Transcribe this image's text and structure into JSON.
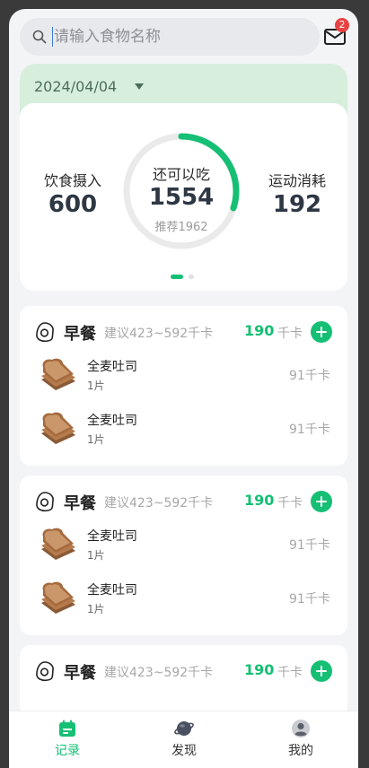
{
  "search": {
    "placeholder": "请输入食物名称",
    "badge_count": "2"
  },
  "date": {
    "value": "2024/04/04"
  },
  "summary": {
    "intake_label": "饮食摄入",
    "intake_value": "600",
    "remaining_label": "还可以吃",
    "remaining_value": "1554",
    "recommended_text": "推荐1962",
    "burn_label": "运动消耗",
    "burn_value": "192",
    "ring_progress": 0.3
  },
  "meals": [
    {
      "title": "早餐",
      "suggestion": "建议423~592千卡",
      "kcal": "190",
      "kcal_unit": "千卡",
      "foods": [
        {
          "name": "全麦吐司",
          "qty": "1片",
          "kcal": "91千卡"
        },
        {
          "name": "全麦吐司",
          "qty": "1片",
          "kcal": "91千卡"
        }
      ]
    },
    {
      "title": "早餐",
      "suggestion": "建议423~592千卡",
      "kcal": "190",
      "kcal_unit": "千卡",
      "foods": [
        {
          "name": "全麦吐司",
          "qty": "1片",
          "kcal": "91千卡"
        },
        {
          "name": "全麦吐司",
          "qty": "1片",
          "kcal": "91千卡"
        }
      ]
    },
    {
      "title": "早餐",
      "suggestion": "建议423~592千卡",
      "kcal": "190",
      "kcal_unit": "千卡",
      "foods": []
    }
  ],
  "tabs": [
    {
      "label": "记录",
      "icon": "calendar-icon",
      "active": true
    },
    {
      "label": "发现",
      "icon": "planet-icon",
      "active": false
    },
    {
      "label": "我的",
      "icon": "profile-icon",
      "active": false
    }
  ],
  "colors": {
    "accent": "#15bf74",
    "date_panel": "#d7eedd"
  }
}
